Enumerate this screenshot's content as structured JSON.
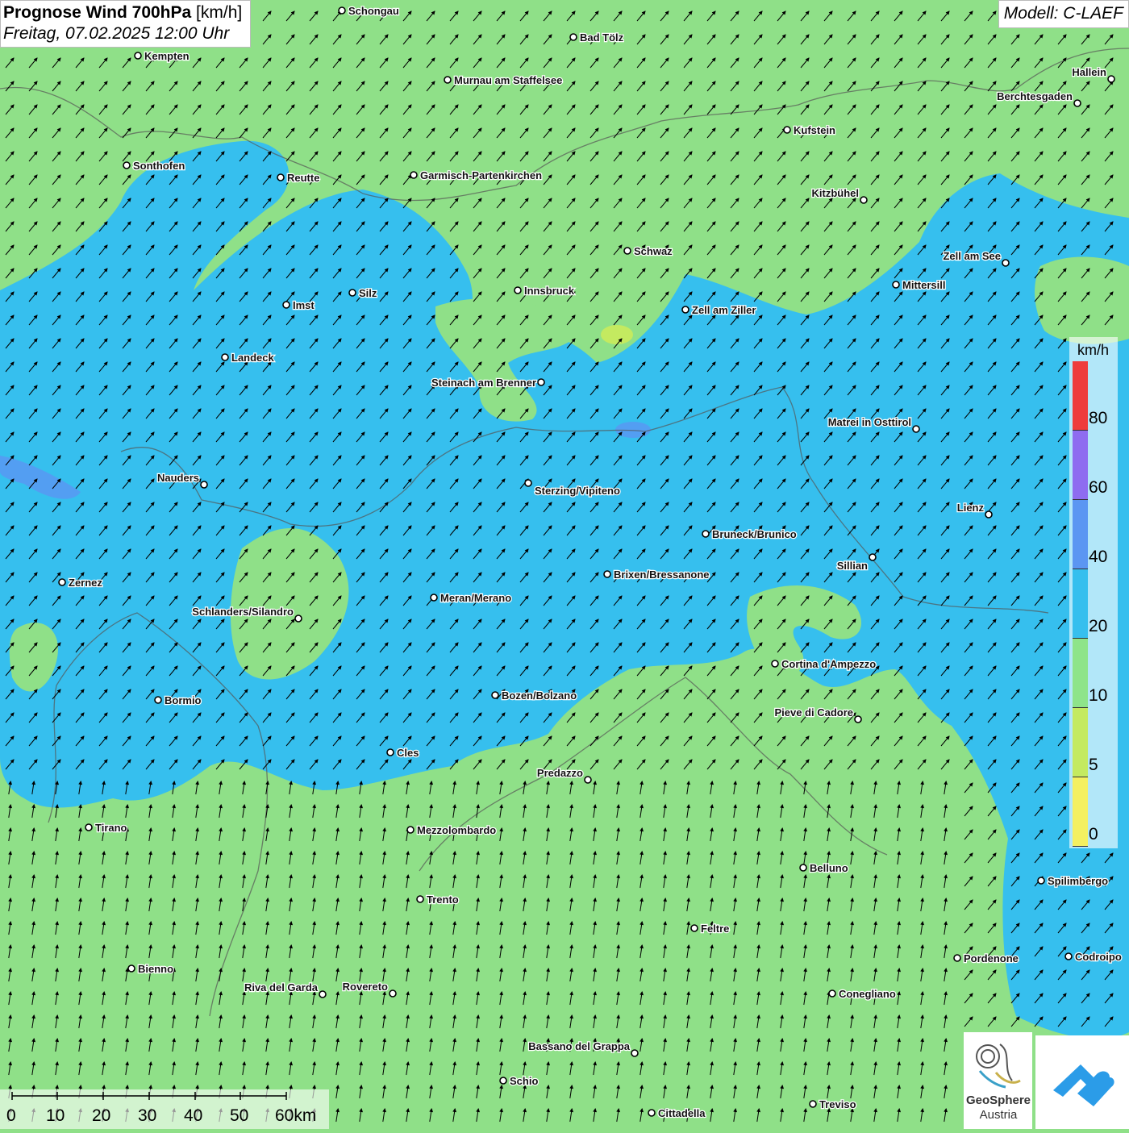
{
  "title": {
    "main_bold": "Prognose Wind 700hPa",
    "unit": "[km/h]",
    "datetime": "Freitag, 07.02.2025 12:00 Uhr"
  },
  "model": "Modell: C-LAEF",
  "legend": {
    "unit": "km/h",
    "levels": [
      "80",
      "60",
      "40",
      "20",
      "10",
      "5",
      "0"
    ],
    "colors": [
      "#ee3c3c",
      "#8e6cf0",
      "#5b96f2",
      "#36bfee",
      "#8ee48a",
      "#c4ea60",
      "#f4f060"
    ]
  },
  "scale_bar": {
    "labels": [
      "0",
      "10",
      "20",
      "30",
      "40",
      "50",
      "60km"
    ]
  },
  "logo": {
    "name_line1": "GeoSphere",
    "name_line2": "Austria"
  },
  "cities": [
    {
      "name": "Schongau"
    },
    {
      "name": "Kempten"
    },
    {
      "name": "Bad Tölz"
    },
    {
      "name": "Murnau am Staffelsee"
    },
    {
      "name": "Hallein"
    },
    {
      "name": "Berchtesgaden"
    },
    {
      "name": "Kufstein"
    },
    {
      "name": "Sonthofen"
    },
    {
      "name": "Reutte"
    },
    {
      "name": "Garmisch-Partenkirchen"
    },
    {
      "name": "Kitzbühel"
    },
    {
      "name": "Schwaz"
    },
    {
      "name": "Zell am See"
    },
    {
      "name": "Innsbruck"
    },
    {
      "name": "Mittersill"
    },
    {
      "name": "Imst"
    },
    {
      "name": "Silz"
    },
    {
      "name": "Zell am Ziller"
    },
    {
      "name": "Landeck"
    },
    {
      "name": "Steinach am Brenner"
    },
    {
      "name": "Matrei in Osttirol"
    },
    {
      "name": "Nauders"
    },
    {
      "name": "Sterzing/Vipiteno"
    },
    {
      "name": "Lienz"
    },
    {
      "name": "Bruneck/Brunico"
    },
    {
      "name": "Sillian"
    },
    {
      "name": "Brixen/Bressanone"
    },
    {
      "name": "Zernez"
    },
    {
      "name": "Meran/Merano"
    },
    {
      "name": "Schlanders/Silandro"
    },
    {
      "name": "Cortina d'Ampezzo"
    },
    {
      "name": "Bozen/Bolzano"
    },
    {
      "name": "Bormio"
    },
    {
      "name": "Pieve di Cadore"
    },
    {
      "name": "Cles"
    },
    {
      "name": "Predazzo"
    },
    {
      "name": "Tirano"
    },
    {
      "name": "Mezzolombardo"
    },
    {
      "name": "Belluno"
    },
    {
      "name": "Spilimbergo"
    },
    {
      "name": "Trento"
    },
    {
      "name": "Feltre"
    },
    {
      "name": "Pordenone"
    },
    {
      "name": "Codroipo"
    },
    {
      "name": "Bienno"
    },
    {
      "name": "Riva del Garda"
    },
    {
      "name": "Rovereto"
    },
    {
      "name": "Conegliano"
    },
    {
      "name": "Bassano del Grappa"
    },
    {
      "name": "Schio"
    },
    {
      "name": "Treviso"
    },
    {
      "name": "Cittadella"
    }
  ]
}
